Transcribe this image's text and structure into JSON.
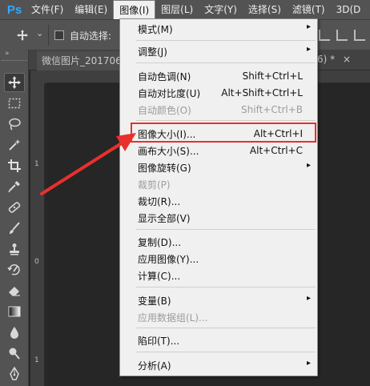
{
  "app": {
    "logo": "Ps"
  },
  "menubar": [
    {
      "label": "文件(F)"
    },
    {
      "label": "编辑(E)"
    },
    {
      "label": "图像(I)"
    },
    {
      "label": "图层(L)"
    },
    {
      "label": "文字(Y)"
    },
    {
      "label": "选择(S)"
    },
    {
      "label": "滤镜(T)"
    },
    {
      "label": "3D(D"
    }
  ],
  "options_bar": {
    "auto_select_label": "自动选择:",
    "dropdown_glyph": "⌄"
  },
  "document": {
    "tab_title": "微信图片_201706",
    "tab_suffix": "6) *",
    "close_glyph": "×",
    "ruler_marks": [
      "1",
      "0",
      "1"
    ]
  },
  "toolbox": {
    "collapse_glyph": "»",
    "tools": [
      {
        "name": "move-tool-icon",
        "selected": true
      },
      {
        "name": "marquee-tool-icon"
      },
      {
        "name": "lasso-tool-icon"
      },
      {
        "name": "magic-wand-tool-icon"
      },
      {
        "name": "crop-tool-icon"
      },
      {
        "name": "eyedropper-tool-icon"
      },
      {
        "name": "healing-brush-tool-icon"
      },
      {
        "name": "brush-tool-icon"
      },
      {
        "name": "clone-stamp-tool-icon"
      },
      {
        "name": "history-brush-tool-icon"
      },
      {
        "name": "eraser-tool-icon"
      },
      {
        "name": "gradient-tool-icon"
      },
      {
        "name": "blur-tool-icon"
      },
      {
        "name": "dodge-tool-icon"
      },
      {
        "name": "pen-tool-icon"
      }
    ]
  },
  "image_menu": {
    "items": [
      {
        "label": "模式(M)",
        "shortcut": "",
        "submenu": true,
        "disabled": false
      },
      {
        "label": "调整(J)",
        "shortcut": "",
        "submenu": true,
        "disabled": false
      },
      {
        "label": "自动色调(N)",
        "shortcut": "Shift+Ctrl+L",
        "submenu": false,
        "disabled": false
      },
      {
        "label": "自动对比度(U)",
        "shortcut": "Alt+Shift+Ctrl+L",
        "submenu": false,
        "disabled": false
      },
      {
        "label": "自动颜色(O)",
        "shortcut": "Shift+Ctrl+B",
        "submenu": false,
        "disabled": true
      },
      {
        "label": "图像大小(I)...",
        "shortcut": "Alt+Ctrl+I",
        "submenu": false,
        "disabled": false,
        "highlighted": true
      },
      {
        "label": "画布大小(S)...",
        "shortcut": "Alt+Ctrl+C",
        "submenu": false,
        "disabled": false
      },
      {
        "label": "图像旋转(G)",
        "shortcut": "",
        "submenu": true,
        "disabled": false
      },
      {
        "label": "裁剪(P)",
        "shortcut": "",
        "submenu": false,
        "disabled": true
      },
      {
        "label": "裁切(R)...",
        "shortcut": "",
        "submenu": false,
        "disabled": false
      },
      {
        "label": "显示全部(V)",
        "shortcut": "",
        "submenu": false,
        "disabled": false
      },
      {
        "label": "复制(D)...",
        "shortcut": "",
        "submenu": false,
        "disabled": false
      },
      {
        "label": "应用图像(Y)...",
        "shortcut": "",
        "submenu": false,
        "disabled": false
      },
      {
        "label": "计算(C)...",
        "shortcut": "",
        "submenu": false,
        "disabled": false
      },
      {
        "label": "变量(B)",
        "shortcut": "",
        "submenu": true,
        "disabled": false
      },
      {
        "label": "应用数据组(L)...",
        "shortcut": "",
        "submenu": false,
        "disabled": true
      },
      {
        "label": "陷印(T)...",
        "shortcut": "",
        "submenu": false,
        "disabled": false
      },
      {
        "label": "分析(A)",
        "shortcut": "",
        "submenu": true,
        "disabled": false
      }
    ],
    "submenu_glyph": "▸"
  },
  "colors": {
    "highlight_red": "#e8302c",
    "ps_blue": "#31a8ff"
  }
}
